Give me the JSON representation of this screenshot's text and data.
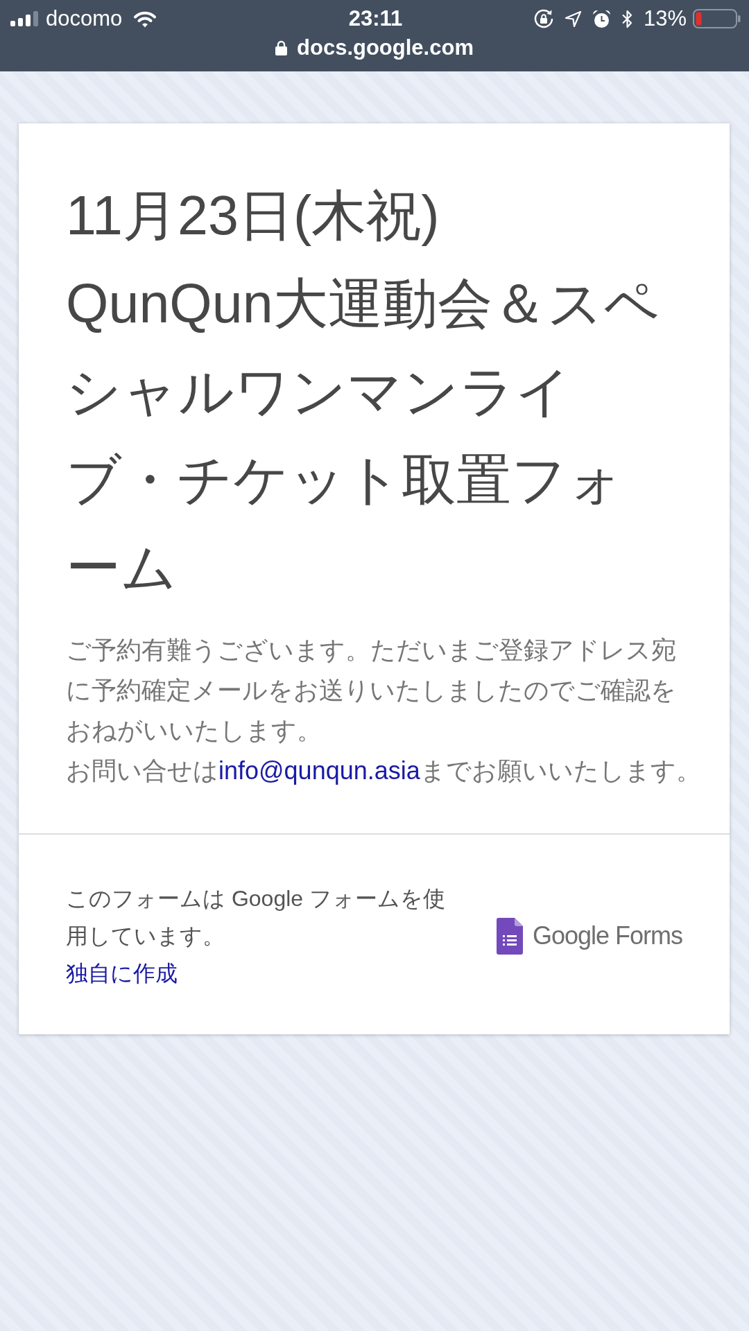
{
  "status_bar": {
    "carrier": "docomo",
    "time": "23:11",
    "battery_percent": "13%",
    "url": "docs.google.com"
  },
  "form": {
    "title": "11月23日(木祝)\nQunQun大運動会＆スペシャルワンマンライブ・チケット取置フォーム",
    "description": "ご予約有難うございます。ただいまご登録アドレス宛に予約確定メールをお送りいたしましたのでご確認をおねがいいたします。",
    "contact": {
      "text_before": "お問い合せは",
      "email_link": "info@qunqun.asia",
      "text_after": "までお願いいたします。"
    }
  },
  "footer": {
    "note": "このフォームは Google フォームを使用しています。",
    "link": "独自に作成",
    "logo_text": "Google Forms"
  }
}
